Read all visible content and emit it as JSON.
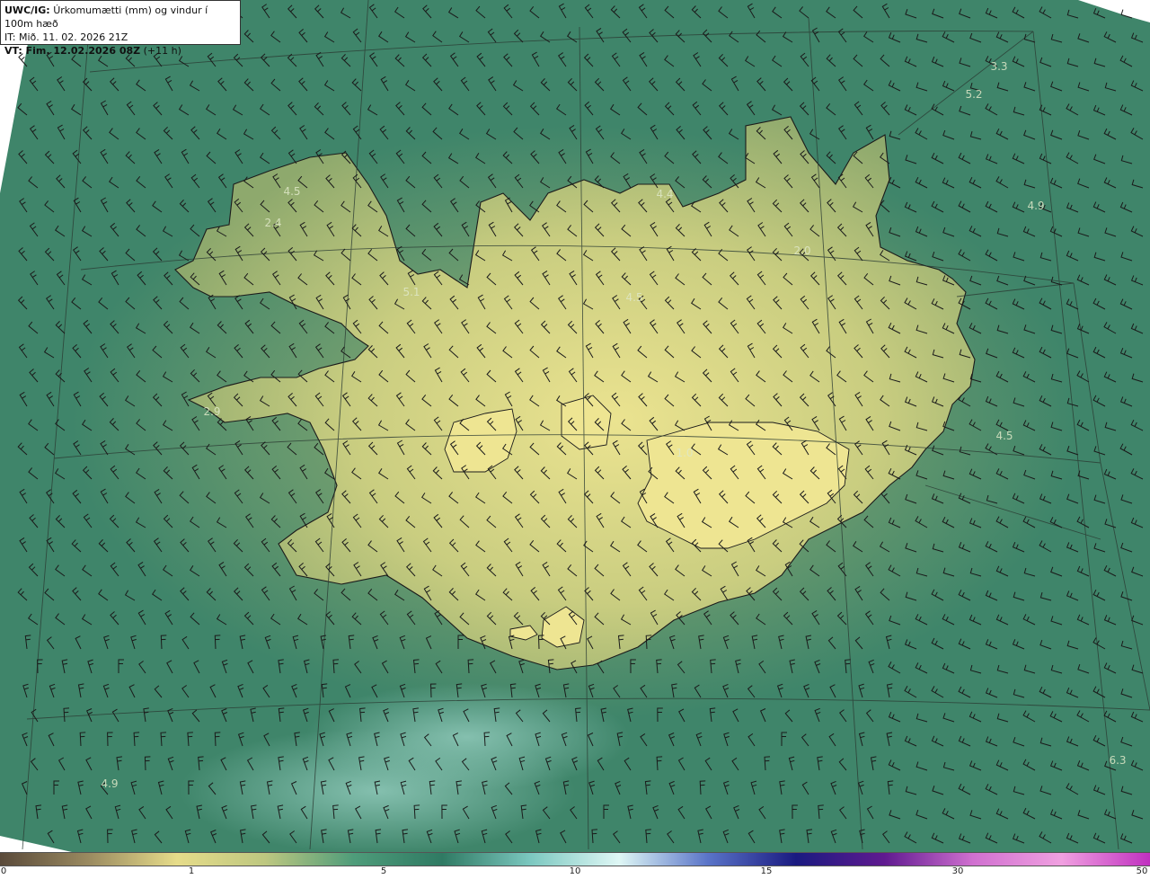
{
  "header": {
    "model_label": "UWC/IG:",
    "field_label": "Úrkomumætti (mm) og vindur í 100m hæð",
    "init_time": "IT: Mið. 11. 02. 2026 21Z",
    "valid_prefix": "VT: Fim. 12.02.2026 08Z",
    "valid_suffix": "(+11 h)"
  },
  "map": {
    "value_labels": [
      "3.3",
      "5.2",
      "4.9",
      "4.5",
      "2.4",
      "5.1",
      "4.4",
      "2.0",
      "4.5",
      "2.9",
      "1.0",
      "4.5",
      "6.3",
      "4.9"
    ],
    "colors": {
      "sea": "#2f7a63",
      "land_high": "#e6e18c",
      "land_mid": "#bcc87d",
      "sea_light": "#7fbcae",
      "coast_line": "#1b1b1b",
      "barb": "#1a1a1a"
    }
  },
  "colorbar": {
    "tick_labels": [
      "0",
      "1",
      "5",
      "10",
      "15",
      "30",
      "50"
    ],
    "stops": [
      "#5a4a3a",
      "#9a8a60",
      "#e6dc8a",
      "#bdc780",
      "#4e9c7a",
      "#2f7a63",
      "#7cc8c0",
      "#dff7f5",
      "#5a74c8",
      "#1a1a80",
      "#601a90",
      "#d070d0",
      "#f0a0e0",
      "#c030c0"
    ]
  }
}
